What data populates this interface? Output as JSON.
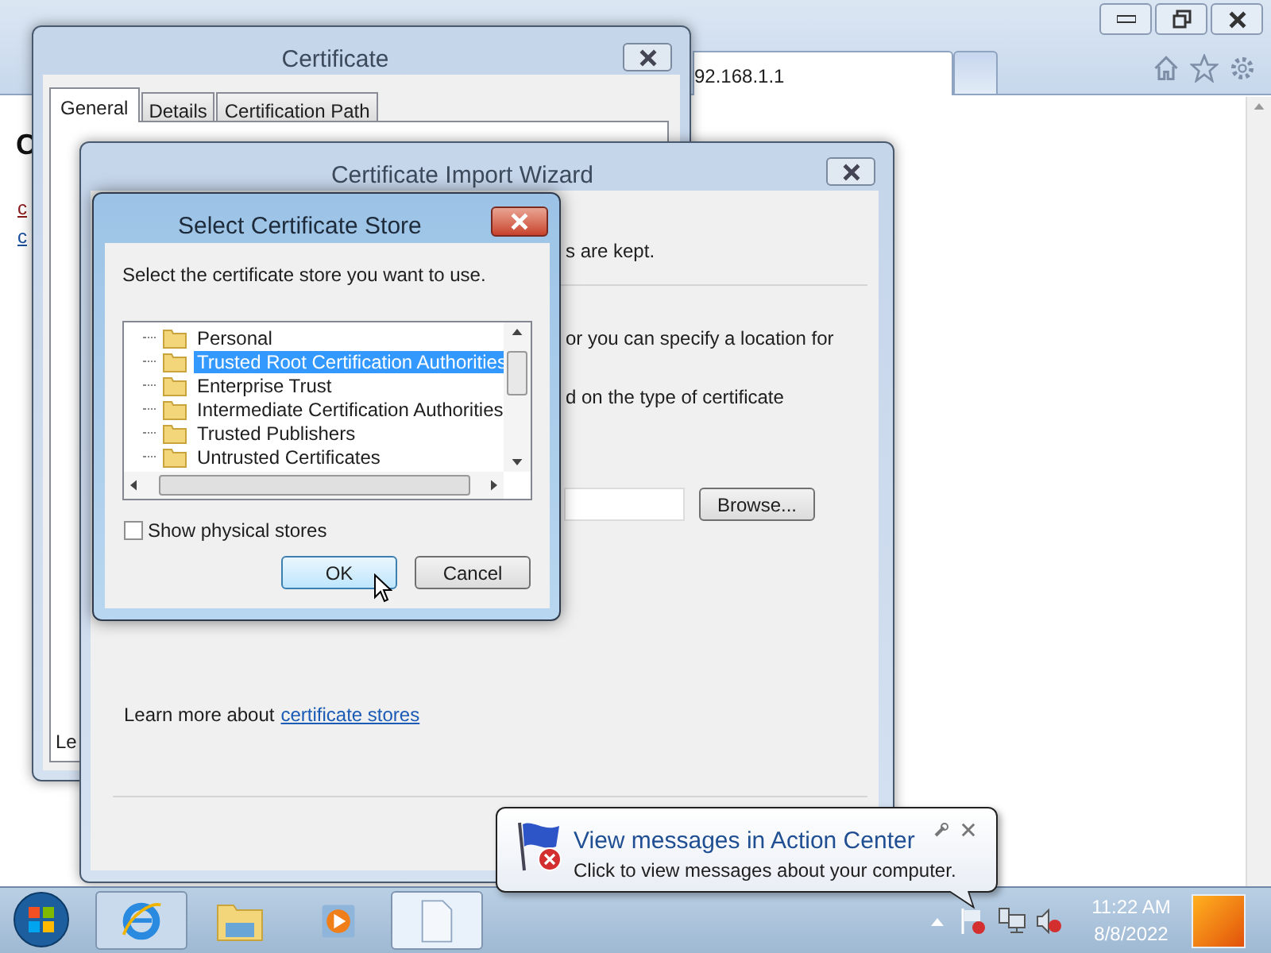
{
  "browser": {
    "address": "92.168.1.1",
    "page_heading": "C",
    "page_links": [
      "c",
      "c"
    ]
  },
  "certificate_dialog": {
    "title": "Certificate",
    "tabs": [
      {
        "label": "General",
        "selected": true
      },
      {
        "label": "Details",
        "selected": false
      },
      {
        "label": "Certification Path",
        "selected": false
      }
    ],
    "footer_text": "Le"
  },
  "import_wizard": {
    "title": "Certificate Import Wizard",
    "lines": [
      "s are kept.",
      "or you can specify a location for",
      "d on the type of certificate"
    ],
    "browse_button": "Browse...",
    "learn_more": "Learn more about",
    "learn_more_link": "certificate stores"
  },
  "store_dialog": {
    "title": "Select Certificate Store",
    "instruction": "Select the certificate store you want to use.",
    "stores": [
      {
        "label": "Personal",
        "selected": false
      },
      {
        "label": "Trusted Root Certification Authorities",
        "selected": true
      },
      {
        "label": "Enterprise Trust",
        "selected": false
      },
      {
        "label": "Intermediate Certification Authorities",
        "selected": false
      },
      {
        "label": "Trusted Publishers",
        "selected": false
      },
      {
        "label": "Untrusted Certificates",
        "selected": false
      }
    ],
    "show_physical_stores": {
      "label": "Show physical stores",
      "checked": false
    },
    "buttons": [
      {
        "label": "OK",
        "default": true
      },
      {
        "label": "Cancel",
        "default": false
      }
    ]
  },
  "notification": {
    "title": "View messages in Action Center",
    "message": "Click to view messages about your computer."
  },
  "taskbar": {
    "apps": [
      {
        "kind": "ie",
        "open": true,
        "selected": false
      },
      {
        "kind": "explorer",
        "open": false,
        "selected": false
      },
      {
        "kind": "media",
        "open": false,
        "selected": false
      },
      {
        "kind": "document",
        "open": true,
        "selected": true
      }
    ],
    "time": "11:22 AM",
    "date": "8/8/2022"
  }
}
